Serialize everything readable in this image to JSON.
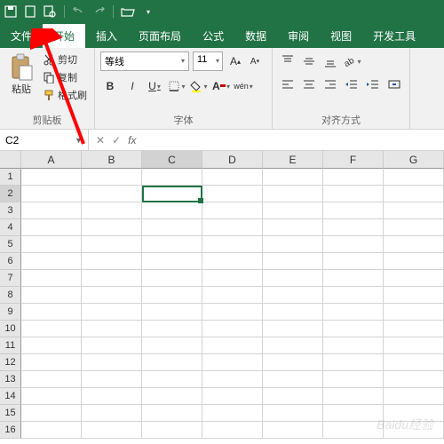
{
  "qat": {
    "save": "保存",
    "new": "新建",
    "preview": "打印预览",
    "undo": "撤销",
    "redo": "重做",
    "open": "打开"
  },
  "tabs": {
    "file": "文件",
    "home": "开始",
    "insert": "插入",
    "layout": "页面布局",
    "formulas": "公式",
    "data": "数据",
    "review": "审阅",
    "view": "视图",
    "dev": "开发工具"
  },
  "ribbon": {
    "clipboard": {
      "paste": "粘贴",
      "cut": "剪切",
      "copy": "复制",
      "format": "格式刷",
      "group": "剪贴板"
    },
    "font": {
      "name": "等线",
      "size": "11",
      "bold": "B",
      "italic": "I",
      "underline": "U",
      "group": "字体",
      "wen": "wén"
    },
    "align": {
      "group": "对齐方式"
    }
  },
  "namebox": "C2",
  "fx": "fx",
  "columns": [
    "A",
    "B",
    "C",
    "D",
    "E",
    "F",
    "G"
  ],
  "rows": [
    "1",
    "2",
    "3",
    "4",
    "5",
    "6",
    "7",
    "8",
    "9",
    "10",
    "11",
    "12",
    "13",
    "14",
    "15",
    "16"
  ],
  "selected": {
    "col": "C",
    "row": "2"
  },
  "watermark": "Baidu经验"
}
